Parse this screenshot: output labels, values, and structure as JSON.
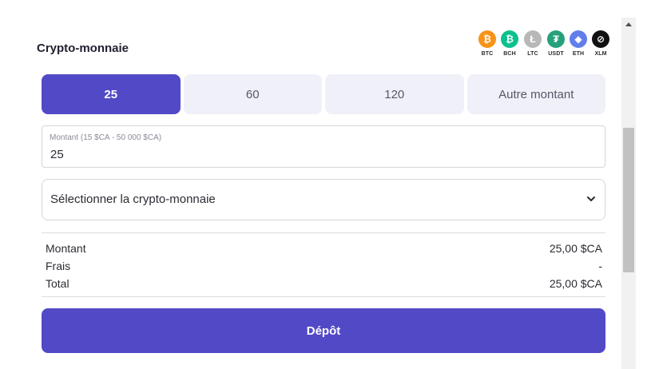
{
  "section": {
    "title": "Crypto-monnaie"
  },
  "coins": [
    {
      "code": "BTC",
      "glyph": "₿",
      "color": "#f7931a",
      "icon": "bitcoin-icon"
    },
    {
      "code": "BCH",
      "glyph": "₿",
      "color": "#0ac18e",
      "icon": "bitcoin-cash-icon"
    },
    {
      "code": "LTC",
      "glyph": "Ł",
      "color": "#b8b8b8",
      "icon": "litecoin-icon"
    },
    {
      "code": "USDT",
      "glyph": "₮",
      "color": "#26a17b",
      "icon": "tether-icon"
    },
    {
      "code": "ETH",
      "glyph": "◆",
      "color": "#627eea",
      "icon": "ethereum-icon"
    },
    {
      "code": "XLM",
      "glyph": "⊘",
      "color": "#111111",
      "icon": "stellar-icon"
    }
  ],
  "amounts": {
    "options": [
      "25",
      "60",
      "120",
      "Autre montant"
    ],
    "selected_index": 0
  },
  "amount_field": {
    "label": "Montant (15 $CA - 50 000 $CA)",
    "value": "25"
  },
  "crypto_select": {
    "placeholder": "Sélectionner la crypto-monnaie"
  },
  "summary": {
    "amount_label": "Montant",
    "amount_value": "25,00 $CA",
    "fees_label": "Frais",
    "fees_value": "-",
    "total_label": "Total",
    "total_value": "25,00 $CA"
  },
  "deposit_button": {
    "label": "Dépôt"
  },
  "colors": {
    "accent": "#5249c6",
    "inactive_option": "#f0f0f8"
  }
}
